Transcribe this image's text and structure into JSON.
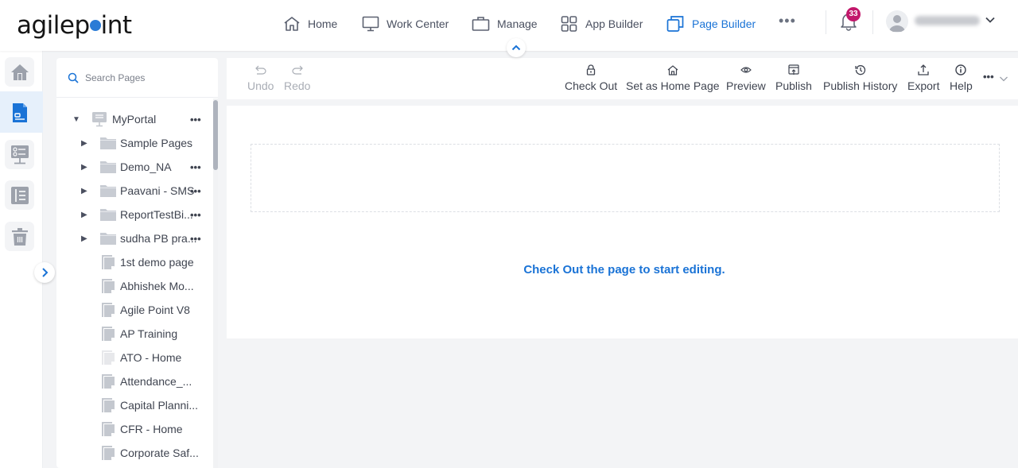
{
  "header": {
    "logo_text_before": "agilep",
    "logo_text_after": "int",
    "nav": [
      {
        "label": "Home",
        "icon": "home-icon",
        "active": false
      },
      {
        "label": "Work Center",
        "icon": "monitor-icon",
        "active": false
      },
      {
        "label": "Manage",
        "icon": "briefcase-icon",
        "active": false
      },
      {
        "label": "App Builder",
        "icon": "grid-icon",
        "active": false
      },
      {
        "label": "Page Builder",
        "icon": "pages-icon",
        "active": true
      }
    ],
    "more_label": "•••",
    "notification_count": "33",
    "user_name_blurred": "",
    "accent_color": "#1a73d6",
    "badge_color": "#c2186b"
  },
  "left_rail": {
    "items": [
      {
        "icon": "home-icon",
        "active": false
      },
      {
        "icon": "page-icon",
        "active": true
      },
      {
        "icon": "portal-list-icon",
        "active": false
      },
      {
        "icon": "list-layout-icon",
        "active": false
      },
      {
        "icon": "trash-icon",
        "active": false
      }
    ]
  },
  "tree": {
    "search_placeholder": "Search Pages",
    "root": {
      "label": "MyPortal",
      "more": "•••"
    },
    "folders": [
      {
        "label": "Sample Pages",
        "more": ""
      },
      {
        "label": "Demo_NA",
        "more": "•••"
      },
      {
        "label": "Paavani - SMS",
        "more": "•••"
      },
      {
        "label": "ReportTestBi...",
        "more": "•••"
      },
      {
        "label": "sudha PB pra...",
        "more": "•••"
      }
    ],
    "pages": [
      {
        "label": "1st demo page",
        "faded": false
      },
      {
        "label": "Abhishek Mo...",
        "faded": false
      },
      {
        "label": "Agile Point V8",
        "faded": false
      },
      {
        "label": "AP Training",
        "faded": false
      },
      {
        "label": "ATO - Home",
        "faded": true
      },
      {
        "label": "Attendance_...",
        "faded": false
      },
      {
        "label": "Capital Planni...",
        "faded": false
      },
      {
        "label": "CFR - Home",
        "faded": false
      },
      {
        "label": "Corporate Saf...",
        "faded": false
      }
    ]
  },
  "toolbar": {
    "undo": "Undo",
    "redo": "Redo",
    "check_out": "Check Out",
    "set_home": "Set as Home Page",
    "preview": "Preview",
    "publish": "Publish",
    "publish_history": "Publish History",
    "export": "Export",
    "help": "Help",
    "more": "•••"
  },
  "canvas": {
    "message": "Check Out the page to start editing."
  }
}
